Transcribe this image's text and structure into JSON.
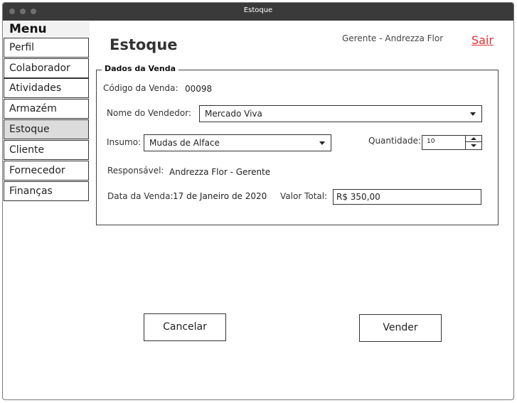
{
  "window": {
    "title": "Estoque"
  },
  "menu": {
    "header": "Menu",
    "items": [
      {
        "label": "Perfil"
      },
      {
        "label": "Colaborador"
      },
      {
        "label": "Atividades"
      },
      {
        "label": "Armazém"
      },
      {
        "label": "Estoque",
        "active": true
      },
      {
        "label": "Cliente"
      },
      {
        "label": "Fornecedor"
      },
      {
        "label": "Finanças"
      }
    ]
  },
  "header": {
    "title": "Estoque",
    "user": "Gerente - Andrezza Flor",
    "logout": "Sair"
  },
  "form": {
    "legend": "Dados da Venda",
    "sale_code_label": "Código da Venda:",
    "sale_code_value": "00098",
    "seller_label": "Nome do Vendedor:",
    "seller_value": "Mercado Viva",
    "input_label": "Insumo:",
    "input_value": "Mudas de Alface",
    "quantity_label": "Quantidade:",
    "quantity_value": "10",
    "responsible_label": "Responsável:",
    "responsible_value": "Andrezza Flor - Gerente",
    "date_label": "Data da Venda:",
    "date_value": "17 de Janeiro de 2020",
    "total_label": "Valor Total:",
    "total_value": "R$ 350,00"
  },
  "actions": {
    "cancel": "Cancelar",
    "sell": "Vender"
  },
  "colors": {
    "titlebar": "#3a3a3a",
    "logout_link": "#e03030",
    "active_menu": "#dcdcdc"
  }
}
